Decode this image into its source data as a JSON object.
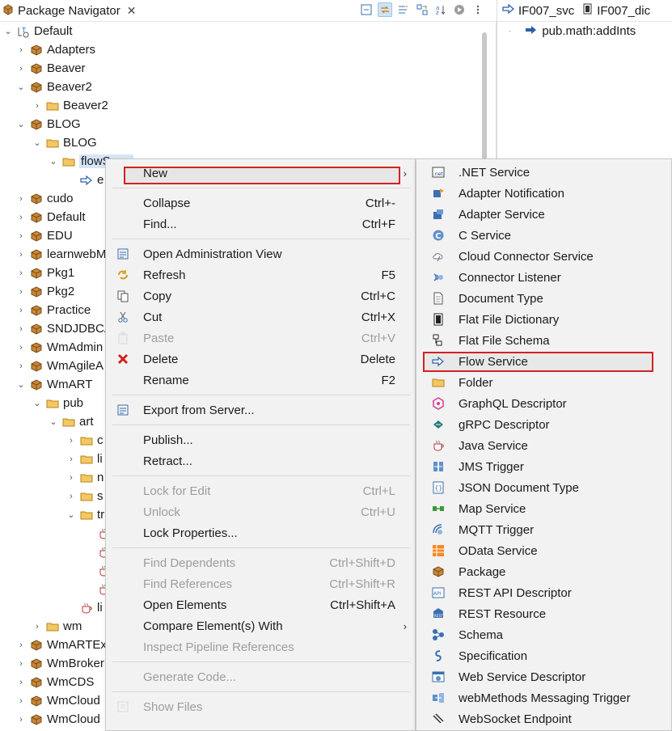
{
  "navigator": {
    "title": "Package Navigator",
    "close": "✕",
    "toolbar": [
      "collapse-all-icon",
      "link-editor-icon",
      "filter-icon",
      "refresh-icon",
      "sort-icon",
      "run-icon",
      "view-menu-icon"
    ],
    "tree": [
      {
        "label": "Default",
        "level": 0,
        "chev": "⌄",
        "icon": "server-icon",
        "kind": "server"
      },
      {
        "label": "Adapters",
        "level": 1,
        "chev": "›",
        "icon": "package-icon",
        "kind": "pkg"
      },
      {
        "label": "Beaver",
        "level": 1,
        "chev": "›",
        "icon": "package-icon",
        "kind": "pkg"
      },
      {
        "label": "Beaver2",
        "level": 1,
        "chev": "⌄",
        "icon": "package-icon",
        "kind": "pkg"
      },
      {
        "label": "Beaver2",
        "level": 2,
        "chev": "›",
        "icon": "folder-icon",
        "kind": "folder"
      },
      {
        "label": "BLOG",
        "level": 1,
        "chev": "⌄",
        "icon": "package-icon",
        "kind": "pkg"
      },
      {
        "label": "BLOG",
        "level": 2,
        "chev": "⌄",
        "icon": "folder-icon",
        "kind": "folder"
      },
      {
        "label": "flowS",
        "level": 3,
        "chev": "⌄",
        "icon": "folder-icon",
        "kind": "folder",
        "selected": true
      },
      {
        "label": "e",
        "level": 4,
        "chev": "",
        "icon": "flow-service-icon",
        "kind": "flow"
      },
      {
        "label": "cudo",
        "level": 1,
        "chev": "›",
        "icon": "package-icon",
        "kind": "pkg"
      },
      {
        "label": "Default",
        "level": 1,
        "chev": "›",
        "icon": "package-icon",
        "kind": "pkg"
      },
      {
        "label": "EDU",
        "level": 1,
        "chev": "›",
        "icon": "package-icon",
        "kind": "pkg"
      },
      {
        "label": "learnwebM",
        "level": 1,
        "chev": "›",
        "icon": "package-icon",
        "kind": "pkg"
      },
      {
        "label": "Pkg1",
        "level": 1,
        "chev": "›",
        "icon": "package-icon",
        "kind": "pkg"
      },
      {
        "label": "Pkg2",
        "level": 1,
        "chev": "›",
        "icon": "package-icon",
        "kind": "pkg"
      },
      {
        "label": "Practice",
        "level": 1,
        "chev": "›",
        "icon": "package-icon",
        "kind": "pkg"
      },
      {
        "label": "SNDJDBCA",
        "level": 1,
        "chev": "›",
        "icon": "package-icon",
        "kind": "pkg"
      },
      {
        "label": "WmAdmin",
        "level": 1,
        "chev": "›",
        "icon": "package-icon",
        "kind": "pkg"
      },
      {
        "label": "WmAgileA",
        "level": 1,
        "chev": "›",
        "icon": "package-icon",
        "kind": "pkg"
      },
      {
        "label": "WmART",
        "level": 1,
        "chev": "⌄",
        "icon": "package-icon",
        "kind": "pkg"
      },
      {
        "label": "pub",
        "level": 2,
        "chev": "⌄",
        "icon": "folder-icon",
        "kind": "folder"
      },
      {
        "label": "art",
        "level": 3,
        "chev": "⌄",
        "icon": "folder-icon",
        "kind": "folder"
      },
      {
        "label": "c",
        "level": 4,
        "chev": "›",
        "icon": "folder-icon",
        "kind": "folder"
      },
      {
        "label": "li",
        "level": 4,
        "chev": "›",
        "icon": "folder-icon",
        "kind": "folder"
      },
      {
        "label": "n",
        "level": 4,
        "chev": "›",
        "icon": "folder-icon",
        "kind": "folder"
      },
      {
        "label": "s",
        "level": 4,
        "chev": "›",
        "icon": "folder-icon",
        "kind": "folder"
      },
      {
        "label": "tr",
        "level": 4,
        "chev": "⌄",
        "icon": "folder-icon",
        "kind": "folder"
      },
      {
        "label": "",
        "level": 5,
        "chev": "",
        "icon": "java-service-icon",
        "kind": "java"
      },
      {
        "label": "",
        "level": 5,
        "chev": "",
        "icon": "java-service-icon",
        "kind": "java"
      },
      {
        "label": "",
        "level": 5,
        "chev": "",
        "icon": "java-service-icon",
        "kind": "java"
      },
      {
        "label": "",
        "level": 5,
        "chev": "",
        "icon": "java-service-icon",
        "kind": "java"
      },
      {
        "label": "li",
        "level": 4,
        "chev": "",
        "icon": "java-service-icon",
        "kind": "java"
      },
      {
        "label": "wm",
        "level": 2,
        "chev": "›",
        "icon": "folder-icon",
        "kind": "folder"
      },
      {
        "label": "WmARTEx",
        "level": 1,
        "chev": "›",
        "icon": "package-icon",
        "kind": "pkg"
      },
      {
        "label": "WmBroker",
        "level": 1,
        "chev": "›",
        "icon": "package-icon",
        "kind": "pkg"
      },
      {
        "label": "WmCDS",
        "level": 1,
        "chev": "›",
        "icon": "package-icon",
        "kind": "pkg"
      },
      {
        "label": "WmCloud",
        "level": 1,
        "chev": "›",
        "icon": "package-icon",
        "kind": "pkg"
      },
      {
        "label": "WmCloud",
        "level": 1,
        "chev": "›",
        "icon": "package-icon",
        "kind": "pkg"
      }
    ]
  },
  "editor": {
    "tabs": [
      {
        "label": "IF007_svc",
        "icon": "flow-service-icon"
      },
      {
        "label": "IF007_dic",
        "icon": "flat-file-dictionary-icon"
      }
    ],
    "line": "pub.math:addInts"
  },
  "context_menu": [
    {
      "label": "New",
      "accel": "",
      "icon": "",
      "submenu": true,
      "disabled": false,
      "highlighted": true
    },
    {
      "sep": true
    },
    {
      "label": "Collapse",
      "accel": "Ctrl+-",
      "icon": "",
      "disabled": false
    },
    {
      "label": "Find...",
      "accel": "Ctrl+F",
      "icon": "",
      "disabled": false
    },
    {
      "sep": true
    },
    {
      "label": "Open Administration View",
      "accel": "",
      "icon": "admin-view-icon",
      "disabled": false
    },
    {
      "label": "Refresh",
      "accel": "F5",
      "icon": "refresh-icon",
      "disabled": false
    },
    {
      "label": "Copy",
      "accel": "Ctrl+C",
      "icon": "copy-icon",
      "disabled": false
    },
    {
      "label": "Cut",
      "accel": "Ctrl+X",
      "icon": "cut-icon",
      "disabled": false
    },
    {
      "label": "Paste",
      "accel": "Ctrl+V",
      "icon": "paste-icon",
      "disabled": true
    },
    {
      "label": "Delete",
      "accel": "Delete",
      "icon": "delete-icon",
      "disabled": false
    },
    {
      "label": "Rename",
      "accel": "F2",
      "icon": "",
      "disabled": false
    },
    {
      "sep": true
    },
    {
      "label": "Export from Server...",
      "accel": "",
      "icon": "export-icon",
      "disabled": false
    },
    {
      "sep": true
    },
    {
      "label": "Publish...",
      "accel": "",
      "icon": "",
      "disabled": false
    },
    {
      "label": "Retract...",
      "accel": "",
      "icon": "",
      "disabled": false
    },
    {
      "sep": true
    },
    {
      "label": "Lock for Edit",
      "accel": "Ctrl+L",
      "icon": "",
      "disabled": true
    },
    {
      "label": "Unlock",
      "accel": "Ctrl+U",
      "icon": "",
      "disabled": true
    },
    {
      "label": "Lock Properties...",
      "accel": "",
      "icon": "",
      "disabled": false
    },
    {
      "sep": true
    },
    {
      "label": "Find Dependents",
      "accel": "Ctrl+Shift+D",
      "icon": "",
      "disabled": true
    },
    {
      "label": "Find References",
      "accel": "Ctrl+Shift+R",
      "icon": "",
      "disabled": true
    },
    {
      "label": "Open Elements",
      "accel": "Ctrl+Shift+A",
      "icon": "",
      "disabled": false
    },
    {
      "label": "Compare Element(s) With",
      "accel": "",
      "icon": "",
      "submenu": true,
      "disabled": false
    },
    {
      "label": "Inspect Pipeline References",
      "accel": "",
      "icon": "",
      "disabled": true
    },
    {
      "sep": true
    },
    {
      "label": "Generate Code...",
      "accel": "",
      "icon": "",
      "disabled": true
    },
    {
      "sep": true
    },
    {
      "label": "Show Files",
      "accel": "",
      "icon": "show-files-icon",
      "disabled": true
    }
  ],
  "submenu": [
    {
      "label": ".NET Service",
      "icon": "dotnet-service-icon"
    },
    {
      "label": "Adapter Notification",
      "icon": "adapter-notification-icon"
    },
    {
      "label": "Adapter Service",
      "icon": "adapter-service-icon"
    },
    {
      "label": "C Service",
      "icon": "c-service-icon"
    },
    {
      "label": "Cloud Connector Service",
      "icon": "cloud-connector-icon"
    },
    {
      "label": "Connector Listener",
      "icon": "connector-listener-icon"
    },
    {
      "label": "Document Type",
      "icon": "document-type-icon"
    },
    {
      "label": "Flat File Dictionary",
      "icon": "flat-file-dictionary-icon"
    },
    {
      "label": "Flat File Schema",
      "icon": "flat-file-schema-icon"
    },
    {
      "label": "Flow Service",
      "icon": "flow-service-icon",
      "highlighted": true
    },
    {
      "label": "Folder",
      "icon": "folder-icon"
    },
    {
      "label": "GraphQL Descriptor",
      "icon": "graphql-icon"
    },
    {
      "label": "gRPC Descriptor",
      "icon": "grpc-icon"
    },
    {
      "label": "Java Service",
      "icon": "java-service-icon"
    },
    {
      "label": "JMS Trigger",
      "icon": "jms-trigger-icon"
    },
    {
      "label": "JSON Document Type",
      "icon": "json-document-icon"
    },
    {
      "label": "Map Service",
      "icon": "map-service-icon"
    },
    {
      "label": "MQTT Trigger",
      "icon": "mqtt-trigger-icon"
    },
    {
      "label": "OData Service",
      "icon": "odata-service-icon"
    },
    {
      "label": "Package",
      "icon": "package-icon"
    },
    {
      "label": "REST API Descriptor",
      "icon": "rest-api-icon"
    },
    {
      "label": "REST Resource",
      "icon": "rest-resource-icon"
    },
    {
      "label": "Schema",
      "icon": "schema-icon"
    },
    {
      "label": "Specification",
      "icon": "specification-icon"
    },
    {
      "label": "Web Service Descriptor",
      "icon": "web-service-descriptor-icon"
    },
    {
      "label": "webMethods Messaging Trigger",
      "icon": "messaging-trigger-icon"
    },
    {
      "label": "WebSocket Endpoint",
      "icon": "websocket-icon"
    }
  ],
  "colors": {
    "highlight_border": "#d42121",
    "selection": "#d5e6f7",
    "package": "#c8863a",
    "folder": "#e8b04a"
  }
}
